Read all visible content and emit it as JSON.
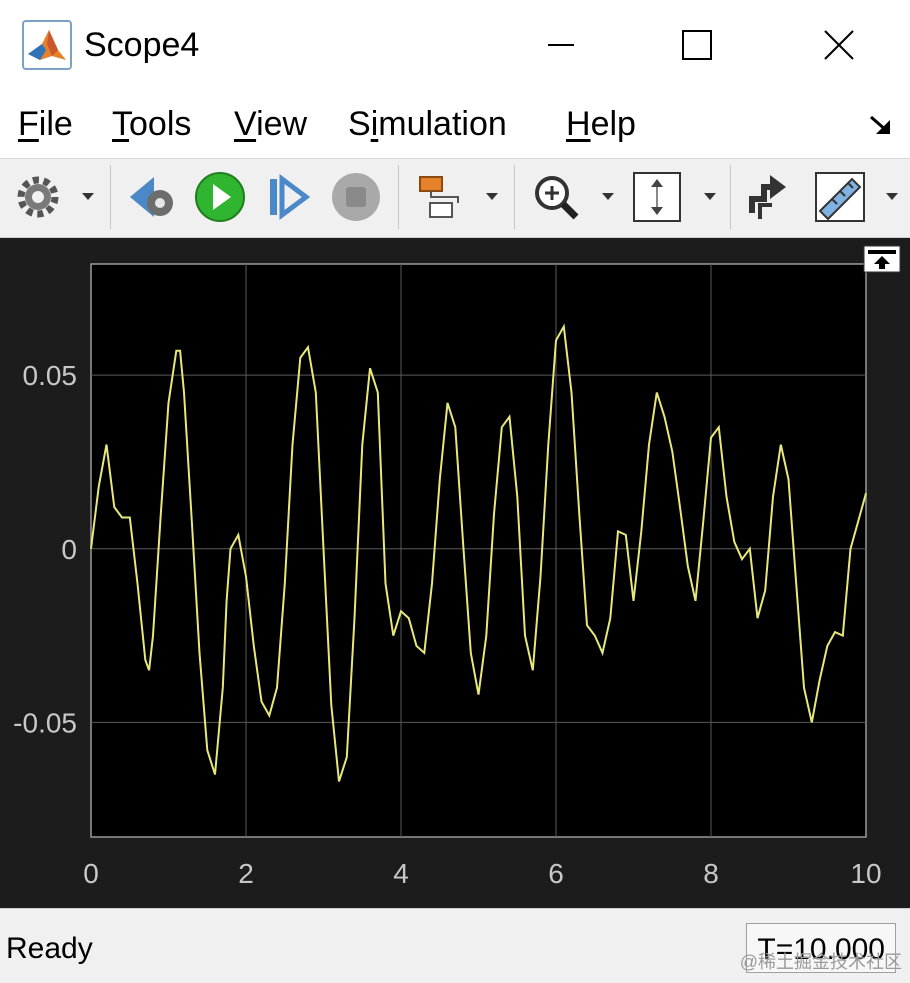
{
  "window": {
    "title": "Scope4"
  },
  "menu": {
    "items": [
      {
        "label": "File",
        "mnemonic": "F",
        "rest": "ile"
      },
      {
        "label": "Tools",
        "mnemonic": "T",
        "rest": "ools"
      },
      {
        "label": "View",
        "mnemonic": "V",
        "rest": "iew"
      },
      {
        "label": "Simulation",
        "pre": "S",
        "mnemonic": "i",
        "rest": "mulation"
      },
      {
        "label": "Help",
        "mnemonic": "H",
        "rest": "elp"
      }
    ]
  },
  "toolbar": {
    "icons": [
      "settings-gear-icon",
      "step-back-icon",
      "run-icon",
      "step-forward-icon",
      "stop-icon",
      "highlight-block-icon",
      "zoom-in-icon",
      "scale-axes-icon",
      "signal-selection-icon",
      "measurements-ruler-icon"
    ]
  },
  "colors": {
    "plot_bg": "#000000",
    "figure_bg": "#1c1c1c",
    "trace": "#e8e87a",
    "grid": "#5a5a5a",
    "tick_text": "#c8c8c8",
    "run_green": "#2fb52f"
  },
  "status": {
    "text": "Ready",
    "time": "T=10.000"
  },
  "watermark": "@稀土掘金技术社区",
  "chart_data": {
    "type": "line",
    "xlim": [
      0,
      10
    ],
    "ylim": [
      -0.083,
      0.082
    ],
    "xticks": [
      0,
      2,
      4,
      6,
      8,
      10
    ],
    "yticks": [
      -0.05,
      0,
      0.05
    ],
    "ytick_labels": [
      "-0.05",
      "0",
      "0.05"
    ],
    "grid": true,
    "series": [
      {
        "x": [
          0,
          0.1,
          0.2,
          0.3,
          0.4,
          0.5,
          0.6,
          0.7,
          0.75,
          0.8,
          0.9,
          1.0,
          1.1,
          1.15,
          1.2,
          1.3,
          1.4,
          1.5,
          1.6,
          1.7,
          1.75,
          1.8,
          1.9,
          2.0,
          2.1,
          2.2,
          2.3,
          2.4,
          2.5,
          2.6,
          2.7,
          2.8,
          2.9,
          3.0,
          3.1,
          3.2,
          3.3,
          3.4,
          3.5,
          3.6,
          3.7,
          3.8,
          3.9,
          4.0,
          4.1,
          4.2,
          4.3,
          4.4,
          4.5,
          4.6,
          4.7,
          4.8,
          4.9,
          5.0,
          5.1,
          5.2,
          5.3,
          5.4,
          5.5,
          5.6,
          5.7,
          5.8,
          5.9,
          6.0,
          6.1,
          6.2,
          6.3,
          6.4,
          6.5,
          6.6,
          6.7,
          6.8,
          6.9,
          7.0,
          7.1,
          7.2,
          7.3,
          7.4,
          7.5,
          7.6,
          7.7,
          7.8,
          7.9,
          8.0,
          8.1,
          8.2,
          8.3,
          8.4,
          8.5,
          8.6,
          8.7,
          8.8,
          8.9,
          9.0,
          9.1,
          9.2,
          9.3,
          9.4,
          9.5,
          9.6,
          9.7,
          9.8,
          9.9,
          10.0
        ],
        "y": [
          0.0,
          0.018,
          0.03,
          0.012,
          0.009,
          0.009,
          -0.01,
          -0.032,
          -0.035,
          -0.025,
          0.01,
          0.042,
          0.057,
          0.057,
          0.045,
          0.008,
          -0.03,
          -0.058,
          -0.065,
          -0.04,
          -0.015,
          0.0,
          0.004,
          -0.008,
          -0.028,
          -0.044,
          -0.048,
          -0.04,
          -0.01,
          0.03,
          0.055,
          0.058,
          0.045,
          0.0,
          -0.045,
          -0.067,
          -0.06,
          -0.02,
          0.03,
          0.052,
          0.045,
          -0.01,
          -0.025,
          -0.018,
          -0.02,
          -0.028,
          -0.03,
          -0.01,
          0.02,
          0.042,
          0.035,
          0.002,
          -0.03,
          -0.042,
          -0.025,
          0.01,
          0.035,
          0.038,
          0.015,
          -0.025,
          -0.035,
          -0.008,
          0.03,
          0.06,
          0.064,
          0.045,
          0.01,
          -0.022,
          -0.025,
          -0.03,
          -0.02,
          0.005,
          0.004,
          -0.015,
          0.005,
          0.03,
          0.045,
          0.038,
          0.028,
          0.012,
          -0.005,
          -0.015,
          0.008,
          0.032,
          0.035,
          0.015,
          0.002,
          -0.003,
          0.0,
          -0.02,
          -0.012,
          0.015,
          0.03,
          0.02,
          -0.01,
          -0.04,
          -0.05,
          -0.038,
          -0.028,
          -0.024,
          -0.025,
          0.0,
          0.008,
          0.016
        ]
      }
    ]
  }
}
